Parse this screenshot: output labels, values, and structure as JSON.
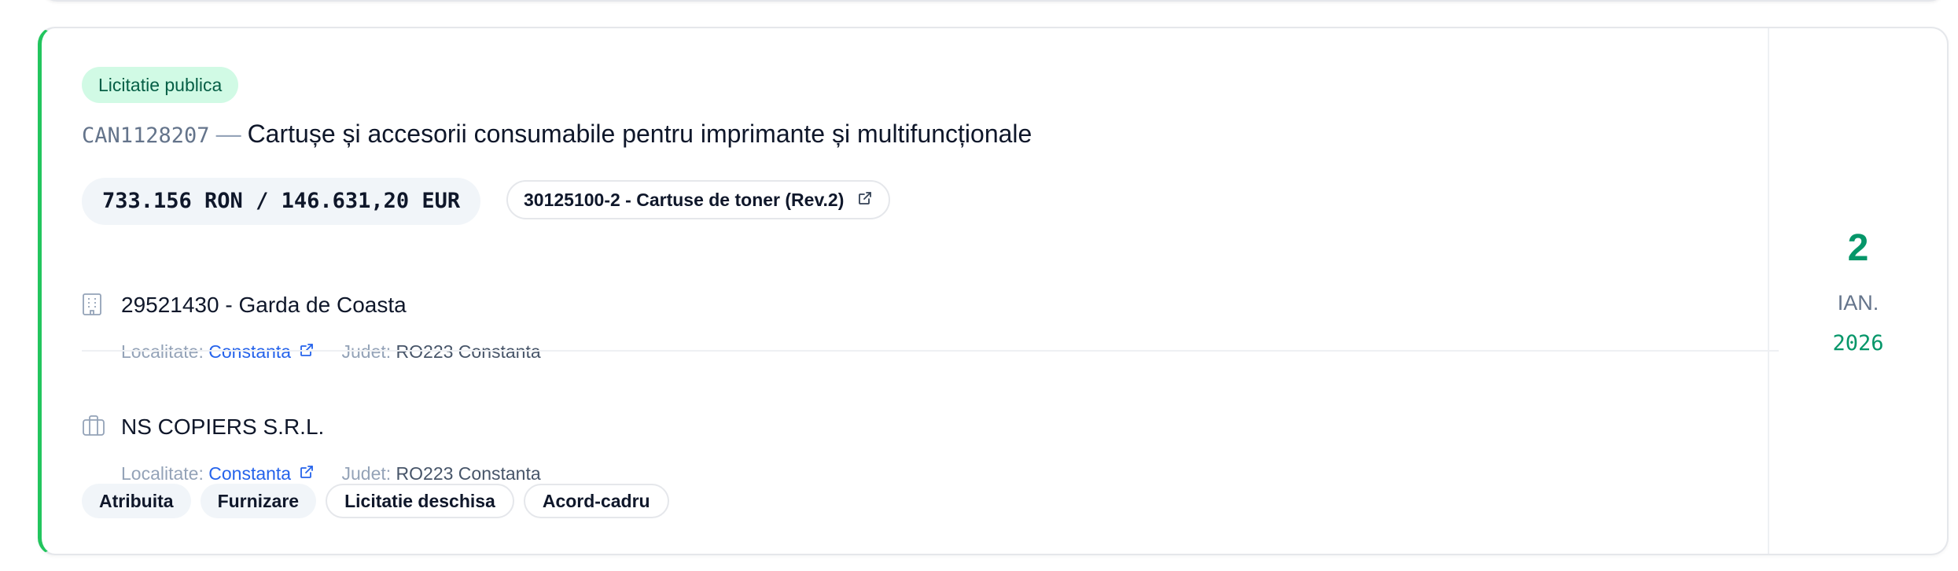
{
  "tender": {
    "procedure_badge": "Licitatie publica",
    "id": "CAN1128207",
    "separator": "—",
    "title": "Cartușe și accesorii consumabile pentru imprimante și multifuncționale",
    "value": "733.156 RON / 146.631,20 EUR",
    "cpv": "30125100-2 - Cartuse de toner (Rev.2)"
  },
  "authority": {
    "icon": "building-icon",
    "name": "29521430 - Garda de Coasta",
    "locality_label": "Localitate:",
    "locality": "Constanta",
    "county_label": "Judet:",
    "county": "RO223 Constanta"
  },
  "supplier": {
    "icon": "briefcase-icon",
    "name": "NS COPIERS S.R.L.",
    "locality_label": "Localitate:",
    "locality": "Constanta",
    "county_label": "Judet:",
    "county": "RO223 Constanta"
  },
  "tags": [
    "Atribuita",
    "Furnizare",
    "Licitatie deschisa",
    "Acord-cadru"
  ],
  "date": {
    "day": "2",
    "month": "IAN.",
    "year": "2026"
  },
  "colors": {
    "accent": "#22c55e",
    "badge_bg": "#d1fae5",
    "date_green": "#059669",
    "link_blue": "#2563eb"
  }
}
